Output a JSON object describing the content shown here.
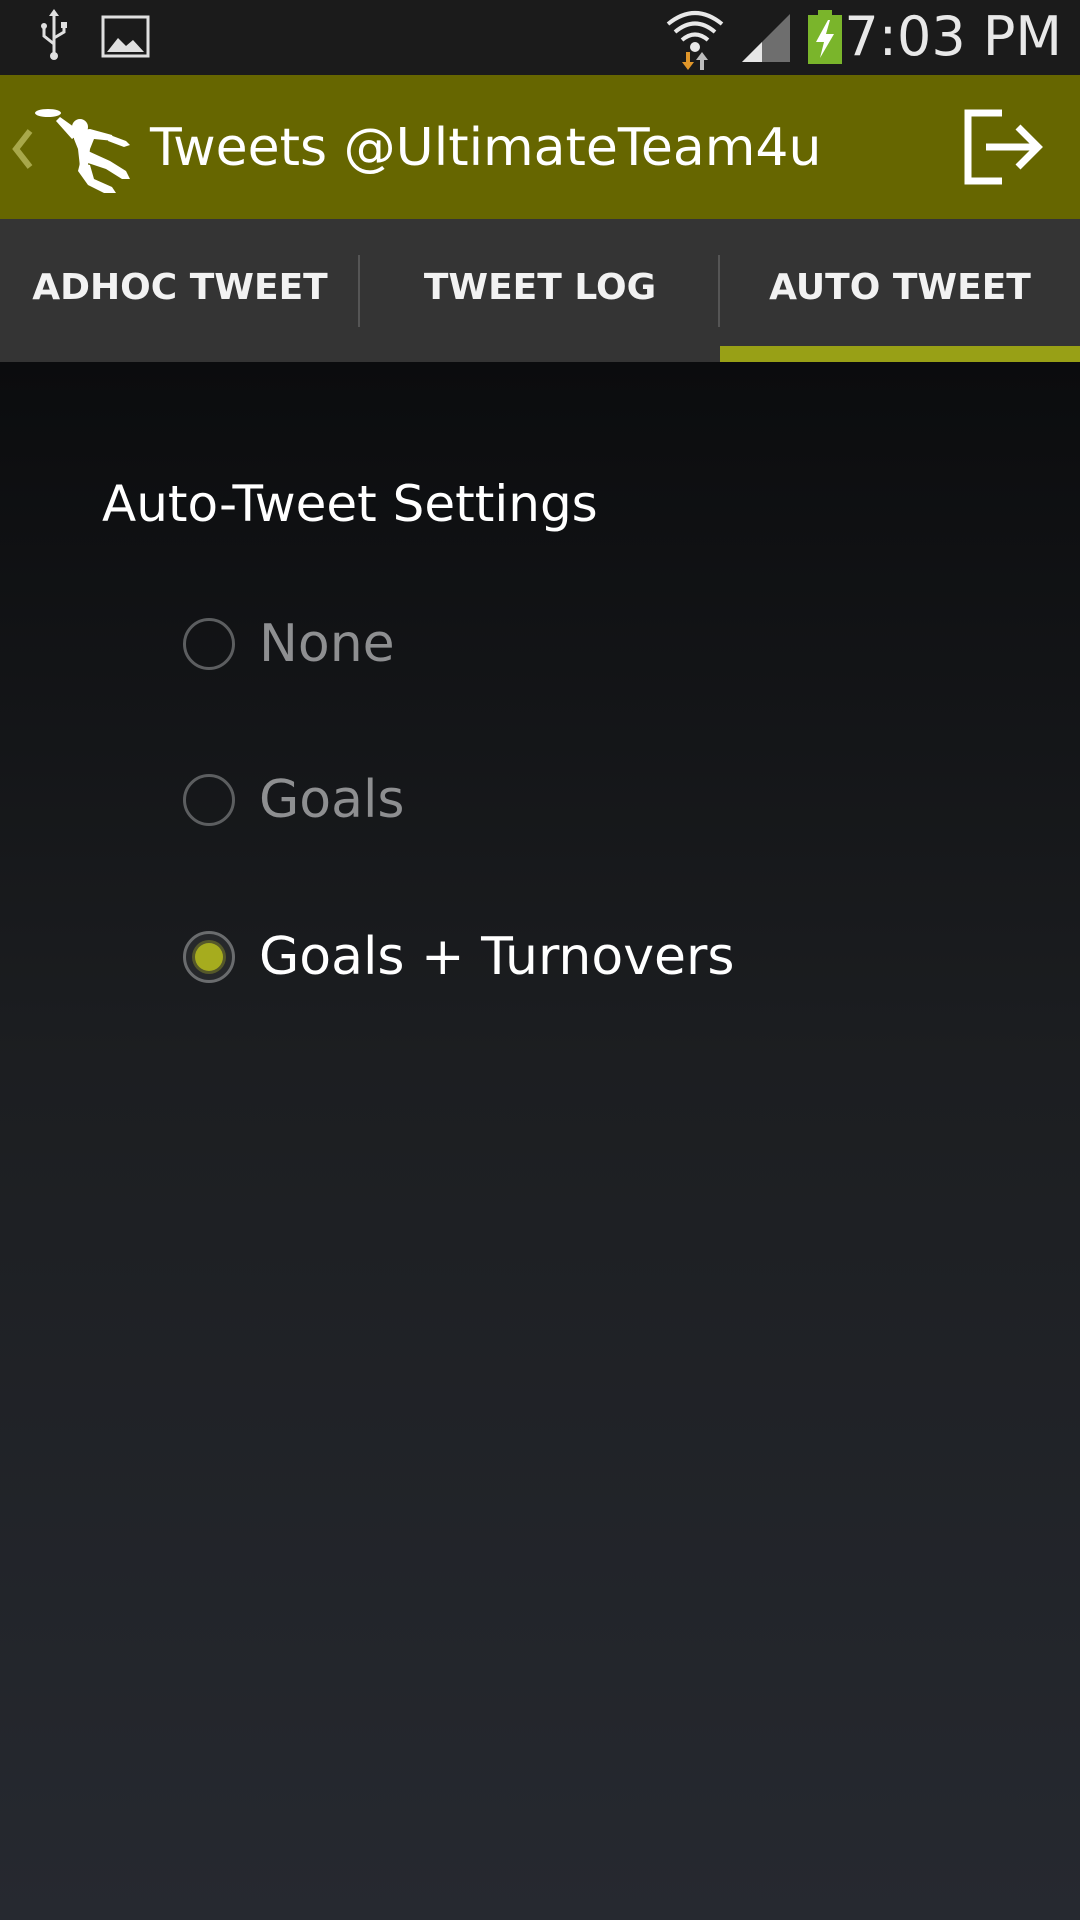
{
  "status_bar": {
    "time": "7:03 PM",
    "icons": [
      "usb-icon",
      "image-icon",
      "wifi-icon",
      "signal-icon",
      "battery-charging-icon"
    ],
    "battery_color": "#7ab52b"
  },
  "action_bar": {
    "title": "Tweets @UltimateTeam4u",
    "background": "#666600",
    "logo": "ultimate-frisbee-player-logo",
    "action_icon": "logout-icon"
  },
  "tabs": [
    {
      "label": "ADHOC TWEET",
      "selected": false
    },
    {
      "label": "TWEET LOG",
      "selected": false
    },
    {
      "label": "AUTO TWEET",
      "selected": true
    }
  ],
  "tab_indicator_color": "#98a016",
  "settings": {
    "title": "Auto-Tweet Settings",
    "options": [
      {
        "label": "None",
        "checked": false
      },
      {
        "label": "Goals",
        "checked": false
      },
      {
        "label": "Goals + Turnovers",
        "checked": true
      }
    ],
    "accent_color": "#a6ac1e"
  }
}
